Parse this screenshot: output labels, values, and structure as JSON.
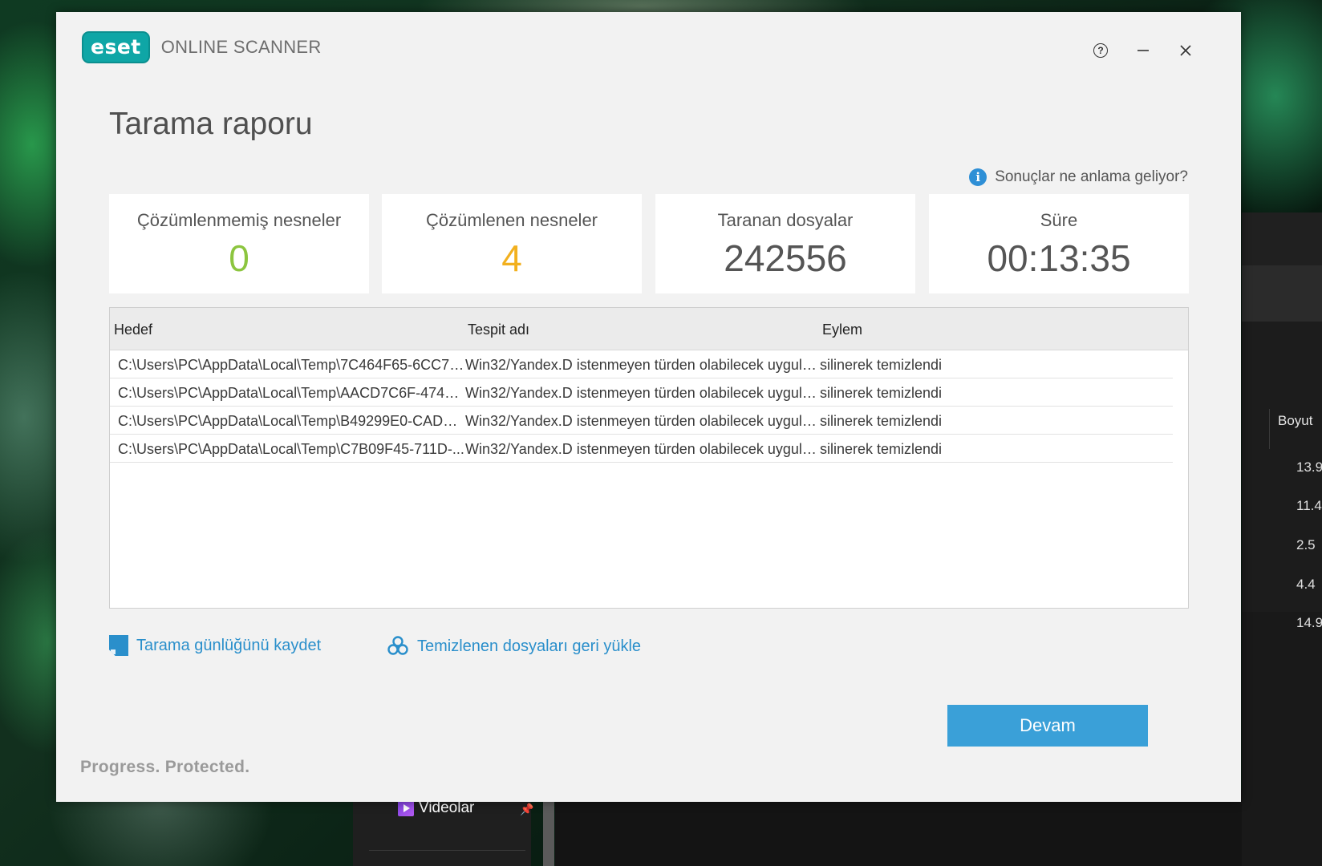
{
  "dialog": {
    "brand": "eset",
    "product": "ONLINE SCANNER",
    "title": "Tarama raporu",
    "help_link": "Sonuçlar ne anlama geliyor?",
    "slogan": "Progress. Protected."
  },
  "stats": [
    {
      "label": "Çözümlenmemiş nesneler",
      "value": "0",
      "color": "#8cc53f"
    },
    {
      "label": "Çözümlenen nesneler",
      "value": "4",
      "color": "#f2b01e"
    },
    {
      "label": "Taranan dosyalar",
      "value": "242556",
      "color": "#555555"
    },
    {
      "label": "Süre",
      "value": "00:13:35",
      "color": "#555555"
    }
  ],
  "table": {
    "columns": [
      "Hedef",
      "Tespit adı",
      "Eylem"
    ],
    "rows": [
      [
        "C:\\Users\\PC\\AppData\\Local\\Temp\\7C464F65-6CC7-4...",
        "Win32/Yandex.D istenmeyen türden olabilecek uygula...",
        "silinerek temizlendi"
      ],
      [
        "C:\\Users\\PC\\AppData\\Local\\Temp\\AACD7C6F-4748-...",
        "Win32/Yandex.D istenmeyen türden olabilecek uygula...",
        "silinerek temizlendi"
      ],
      [
        "C:\\Users\\PC\\AppData\\Local\\Temp\\B49299E0-CAD6-...",
        "Win32/Yandex.D istenmeyen türden olabilecek uygula...",
        "silinerek temizlendi"
      ],
      [
        "C:\\Users\\PC\\AppData\\Local\\Temp\\C7B09F45-711D-...",
        "Win32/Yandex.D istenmeyen türden olabilecek uygula...",
        "silinerek temizlendi"
      ]
    ]
  },
  "actions": {
    "save_log": "Tarama günlüğünü kaydet",
    "restore_files": "Temizlenen dosyaları geri yükle",
    "continue": "Devam"
  },
  "background": {
    "explorer_column": "Boyut",
    "sizes": [
      "13.9",
      "11.4",
      "2.5",
      "4.4",
      "14.9"
    ],
    "nav_item": "Videolar"
  },
  "colors": {
    "accent": "#3aa0d8",
    "link": "#2a8fcb",
    "brand": "#0fa6a6"
  },
  "icons": [
    "eset-logo",
    "help-icon",
    "minimize-icon",
    "close-icon",
    "info-icon",
    "save-icon",
    "biohazard-icon",
    "video-folder-icon",
    "pin-icon"
  ]
}
